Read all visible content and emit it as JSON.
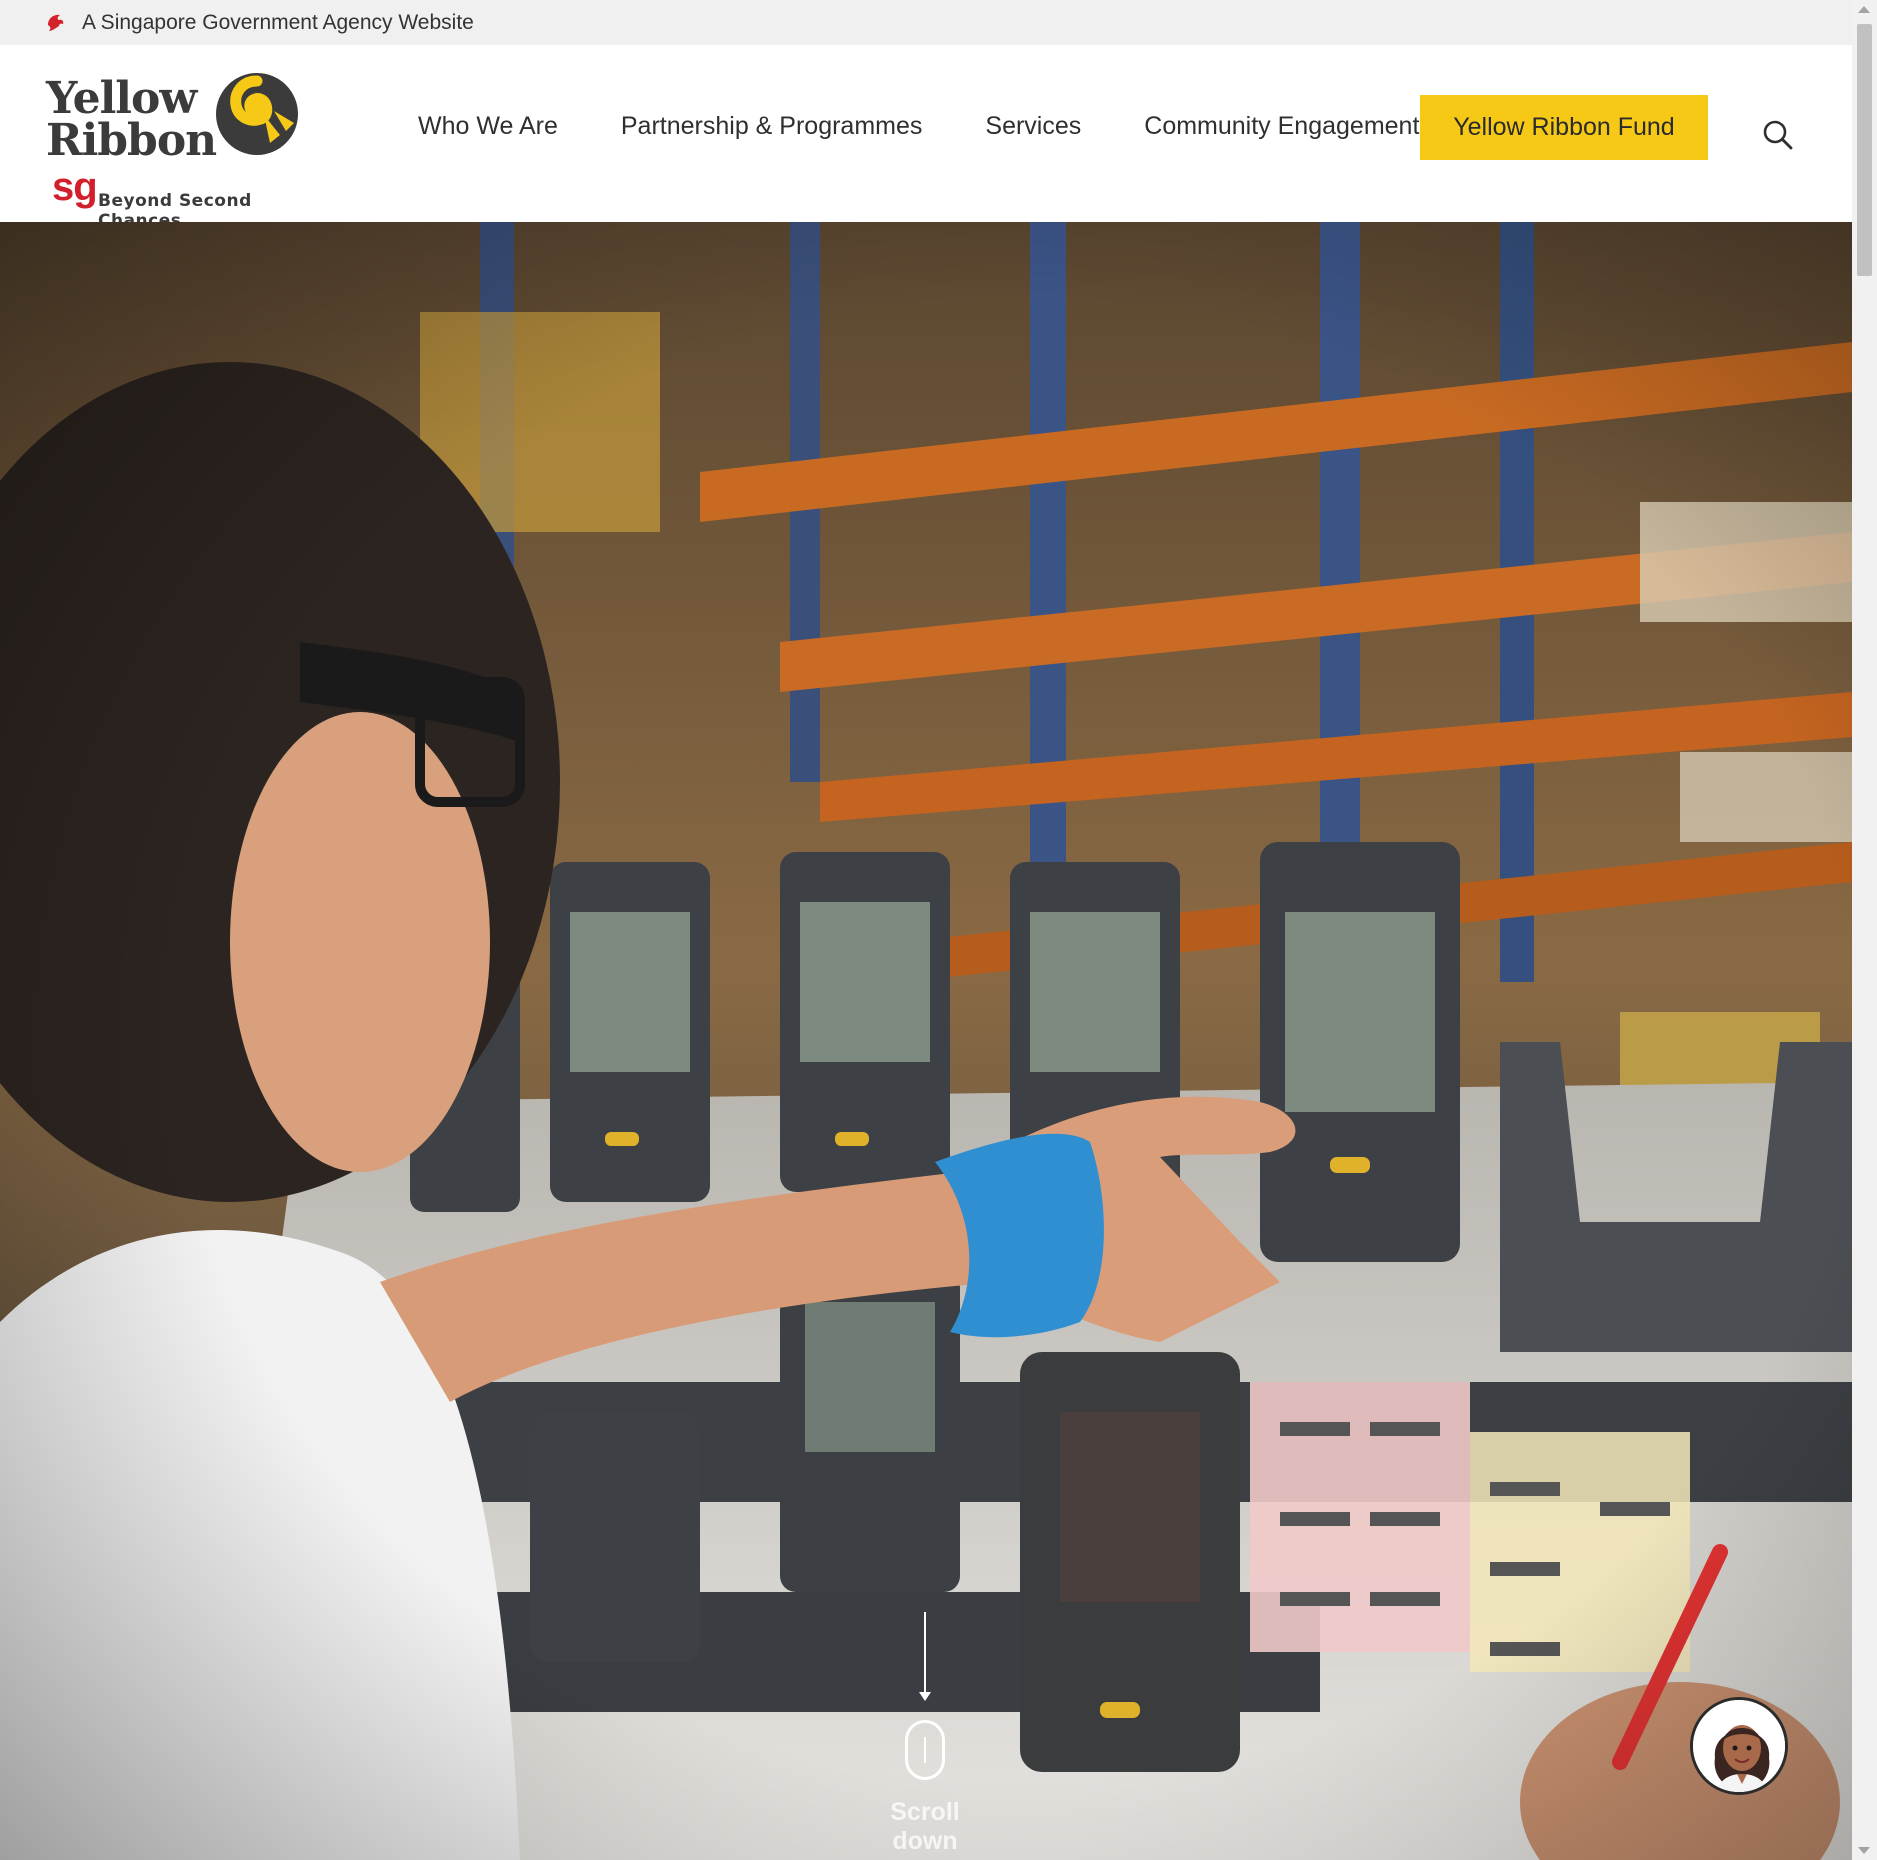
{
  "gov_banner": {
    "text": "A Singapore Government Agency Website",
    "icon": "lion-head-icon"
  },
  "logo": {
    "line1": "Yellow",
    "line2": "Ribbon",
    "sg": "sg",
    "tagline": "Beyond Second Chances",
    "brand_color": "#f7c917",
    "sg_color": "#d21f2c"
  },
  "nav": {
    "items": [
      {
        "label": "Who We Are"
      },
      {
        "label": "Partnership & Programmes"
      },
      {
        "label": "Services"
      },
      {
        "label": "Community Engagement"
      }
    ],
    "cta_label": "Yellow Ribbon Fund",
    "search_icon": "search-icon"
  },
  "hero": {
    "scroll_label": "Scroll down",
    "scroll_icon": "mouse-scroll-icon"
  },
  "chat": {
    "icon": "chatbot-avatar-icon"
  }
}
